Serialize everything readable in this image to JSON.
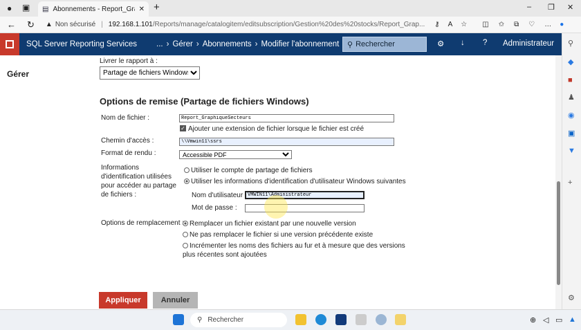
{
  "browser": {
    "tab_title": "Abonnements - Report_Graphiqu",
    "insecure": "Non sécurisé",
    "url_host": "192.168.1.101",
    "url_path": "/Reports/manage/catalogitem/editsubscription/Gestion%20des%20stocks/Report_Grap..."
  },
  "app": {
    "name": "SQL Server Reporting Services",
    "breadcrumb": [
      "...",
      "Gérer",
      "Abonnements",
      "Modifier l'abonnement"
    ],
    "search_placeholder": "Rechercher",
    "user": "Administrateur"
  },
  "left_nav": {
    "title": "Gérer"
  },
  "form": {
    "deliver_label": "Livrer le rapport à :",
    "deliver_value": "Partage de fichiers Windows",
    "section_title": "Options de remise (Partage de fichiers Windows)",
    "filename_label": "Nom de fichier :",
    "filename_value": "Report_GraphiqueSecteurs",
    "extension_label": "Ajouter une extension de fichier lorsque le fichier est créé",
    "extension_checked": true,
    "path_label": "Chemin d'accès :",
    "path_value": "\\\\Vmwin11\\ssrs",
    "format_label": "Format de rendu :",
    "format_value": "Accessible PDF",
    "cred_label": "Informations d'identification utilisées pour accéder au partage de fichiers :",
    "cred_options": [
      "Utiliser le compte de partage de fichiers",
      "Utiliser les informations d'identification d'utilisateur Windows suivantes"
    ],
    "user_label": "Nom d'utilisateur :",
    "user_value": "VMWIN11\\Administrateur",
    "password_label": "Mot de passe :",
    "overwrite_label": "Options de remplacement :",
    "overwrite_options": [
      "Remplacer un fichier existant par une nouvelle version",
      "Ne pas remplacer le fichier si une version précédente existe",
      "Incrémenter les noms des fichiers au fur et à mesure que des versions plus récentes sont ajoutées"
    ],
    "apply": "Appliquer",
    "cancel": "Annuler"
  },
  "taskbar": {
    "search": "Rechercher"
  },
  "colors": {
    "header": "#0f3b70",
    "accent": "#c8392b"
  }
}
